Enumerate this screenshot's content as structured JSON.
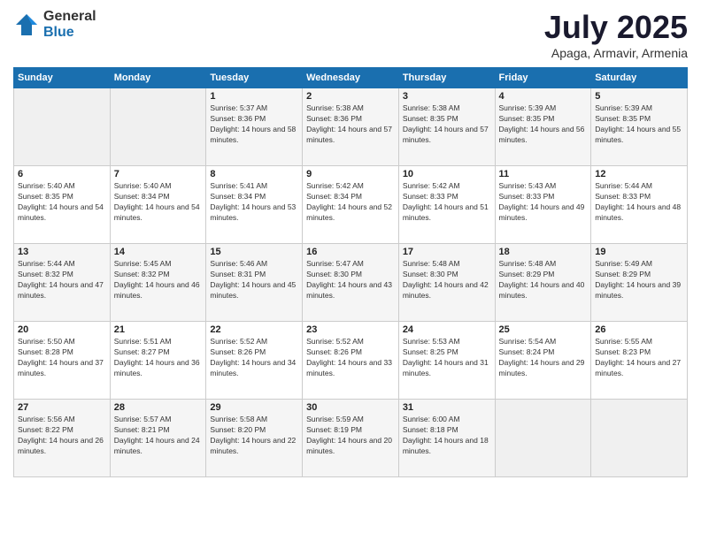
{
  "logo": {
    "general": "General",
    "blue": "Blue"
  },
  "header": {
    "month": "July 2025",
    "location": "Apaga, Armavir, Armenia"
  },
  "weekdays": [
    "Sunday",
    "Monday",
    "Tuesday",
    "Wednesday",
    "Thursday",
    "Friday",
    "Saturday"
  ],
  "weeks": [
    [
      {
        "day": "",
        "sunrise": "",
        "sunset": "",
        "daylight": ""
      },
      {
        "day": "",
        "sunrise": "",
        "sunset": "",
        "daylight": ""
      },
      {
        "day": "1",
        "sunrise": "Sunrise: 5:37 AM",
        "sunset": "Sunset: 8:36 PM",
        "daylight": "Daylight: 14 hours and 58 minutes."
      },
      {
        "day": "2",
        "sunrise": "Sunrise: 5:38 AM",
        "sunset": "Sunset: 8:36 PM",
        "daylight": "Daylight: 14 hours and 57 minutes."
      },
      {
        "day": "3",
        "sunrise": "Sunrise: 5:38 AM",
        "sunset": "Sunset: 8:35 PM",
        "daylight": "Daylight: 14 hours and 57 minutes."
      },
      {
        "day": "4",
        "sunrise": "Sunrise: 5:39 AM",
        "sunset": "Sunset: 8:35 PM",
        "daylight": "Daylight: 14 hours and 56 minutes."
      },
      {
        "day": "5",
        "sunrise": "Sunrise: 5:39 AM",
        "sunset": "Sunset: 8:35 PM",
        "daylight": "Daylight: 14 hours and 55 minutes."
      }
    ],
    [
      {
        "day": "6",
        "sunrise": "Sunrise: 5:40 AM",
        "sunset": "Sunset: 8:35 PM",
        "daylight": "Daylight: 14 hours and 54 minutes."
      },
      {
        "day": "7",
        "sunrise": "Sunrise: 5:40 AM",
        "sunset": "Sunset: 8:34 PM",
        "daylight": "Daylight: 14 hours and 54 minutes."
      },
      {
        "day": "8",
        "sunrise": "Sunrise: 5:41 AM",
        "sunset": "Sunset: 8:34 PM",
        "daylight": "Daylight: 14 hours and 53 minutes."
      },
      {
        "day": "9",
        "sunrise": "Sunrise: 5:42 AM",
        "sunset": "Sunset: 8:34 PM",
        "daylight": "Daylight: 14 hours and 52 minutes."
      },
      {
        "day": "10",
        "sunrise": "Sunrise: 5:42 AM",
        "sunset": "Sunset: 8:33 PM",
        "daylight": "Daylight: 14 hours and 51 minutes."
      },
      {
        "day": "11",
        "sunrise": "Sunrise: 5:43 AM",
        "sunset": "Sunset: 8:33 PM",
        "daylight": "Daylight: 14 hours and 49 minutes."
      },
      {
        "day": "12",
        "sunrise": "Sunrise: 5:44 AM",
        "sunset": "Sunset: 8:33 PM",
        "daylight": "Daylight: 14 hours and 48 minutes."
      }
    ],
    [
      {
        "day": "13",
        "sunrise": "Sunrise: 5:44 AM",
        "sunset": "Sunset: 8:32 PM",
        "daylight": "Daylight: 14 hours and 47 minutes."
      },
      {
        "day": "14",
        "sunrise": "Sunrise: 5:45 AM",
        "sunset": "Sunset: 8:32 PM",
        "daylight": "Daylight: 14 hours and 46 minutes."
      },
      {
        "day": "15",
        "sunrise": "Sunrise: 5:46 AM",
        "sunset": "Sunset: 8:31 PM",
        "daylight": "Daylight: 14 hours and 45 minutes."
      },
      {
        "day": "16",
        "sunrise": "Sunrise: 5:47 AM",
        "sunset": "Sunset: 8:30 PM",
        "daylight": "Daylight: 14 hours and 43 minutes."
      },
      {
        "day": "17",
        "sunrise": "Sunrise: 5:48 AM",
        "sunset": "Sunset: 8:30 PM",
        "daylight": "Daylight: 14 hours and 42 minutes."
      },
      {
        "day": "18",
        "sunrise": "Sunrise: 5:48 AM",
        "sunset": "Sunset: 8:29 PM",
        "daylight": "Daylight: 14 hours and 40 minutes."
      },
      {
        "day": "19",
        "sunrise": "Sunrise: 5:49 AM",
        "sunset": "Sunset: 8:29 PM",
        "daylight": "Daylight: 14 hours and 39 minutes."
      }
    ],
    [
      {
        "day": "20",
        "sunrise": "Sunrise: 5:50 AM",
        "sunset": "Sunset: 8:28 PM",
        "daylight": "Daylight: 14 hours and 37 minutes."
      },
      {
        "day": "21",
        "sunrise": "Sunrise: 5:51 AM",
        "sunset": "Sunset: 8:27 PM",
        "daylight": "Daylight: 14 hours and 36 minutes."
      },
      {
        "day": "22",
        "sunrise": "Sunrise: 5:52 AM",
        "sunset": "Sunset: 8:26 PM",
        "daylight": "Daylight: 14 hours and 34 minutes."
      },
      {
        "day": "23",
        "sunrise": "Sunrise: 5:52 AM",
        "sunset": "Sunset: 8:26 PM",
        "daylight": "Daylight: 14 hours and 33 minutes."
      },
      {
        "day": "24",
        "sunrise": "Sunrise: 5:53 AM",
        "sunset": "Sunset: 8:25 PM",
        "daylight": "Daylight: 14 hours and 31 minutes."
      },
      {
        "day": "25",
        "sunrise": "Sunrise: 5:54 AM",
        "sunset": "Sunset: 8:24 PM",
        "daylight": "Daylight: 14 hours and 29 minutes."
      },
      {
        "day": "26",
        "sunrise": "Sunrise: 5:55 AM",
        "sunset": "Sunset: 8:23 PM",
        "daylight": "Daylight: 14 hours and 27 minutes."
      }
    ],
    [
      {
        "day": "27",
        "sunrise": "Sunrise: 5:56 AM",
        "sunset": "Sunset: 8:22 PM",
        "daylight": "Daylight: 14 hours and 26 minutes."
      },
      {
        "day": "28",
        "sunrise": "Sunrise: 5:57 AM",
        "sunset": "Sunset: 8:21 PM",
        "daylight": "Daylight: 14 hours and 24 minutes."
      },
      {
        "day": "29",
        "sunrise": "Sunrise: 5:58 AM",
        "sunset": "Sunset: 8:20 PM",
        "daylight": "Daylight: 14 hours and 22 minutes."
      },
      {
        "day": "30",
        "sunrise": "Sunrise: 5:59 AM",
        "sunset": "Sunset: 8:19 PM",
        "daylight": "Daylight: 14 hours and 20 minutes."
      },
      {
        "day": "31",
        "sunrise": "Sunrise: 6:00 AM",
        "sunset": "Sunset: 8:18 PM",
        "daylight": "Daylight: 14 hours and 18 minutes."
      },
      {
        "day": "",
        "sunrise": "",
        "sunset": "",
        "daylight": ""
      },
      {
        "day": "",
        "sunrise": "",
        "sunset": "",
        "daylight": ""
      }
    ]
  ]
}
